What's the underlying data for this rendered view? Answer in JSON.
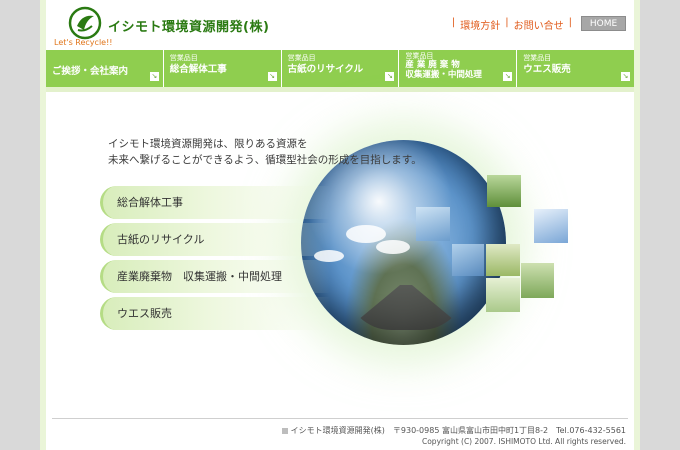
{
  "header": {
    "brand": "イシモト環境資源開発(株)",
    "tagline": "Let's Recycle!!",
    "links": [
      "環境方針",
      "お問い合せ"
    ],
    "home_label": "HOME"
  },
  "nav": {
    "items": [
      {
        "category": "",
        "label": "ご挨拶・会社案内"
      },
      {
        "category": "営業品目",
        "label": "総合解体工事"
      },
      {
        "category": "営業品目",
        "label": "古紙のリサイクル"
      },
      {
        "category": "営業品目",
        "label": "産 業 廃 棄 物",
        "label2": "収集運搬・中間処理"
      },
      {
        "category": "営業品目",
        "label": "ウエス販売"
      }
    ]
  },
  "intro": {
    "line1": "イシモト環境資源開発は、限りある資源を",
    "line2": "未来へ繋げることができるよう、循環型社会の形成を目指します。"
  },
  "menu": {
    "items": [
      "総合解体工事",
      "古紙のリサイクル",
      "産業廃棄物　収集運搬・中間処理",
      "ウエス販売"
    ]
  },
  "footer": {
    "address": "イシモト環境資源開発(株)　〒930-0985 富山県富山市田中町1丁目8-2　Tel.076-432-5561",
    "copyright": "Copyright (C) 2007. ISHIMOTO Ltd. All rights reserved."
  },
  "colors": {
    "nav_green": "#8fce4f",
    "brand_green": "#2a7a12",
    "link_orange": "#e05a1a",
    "home_gray": "#a7a7a7"
  }
}
